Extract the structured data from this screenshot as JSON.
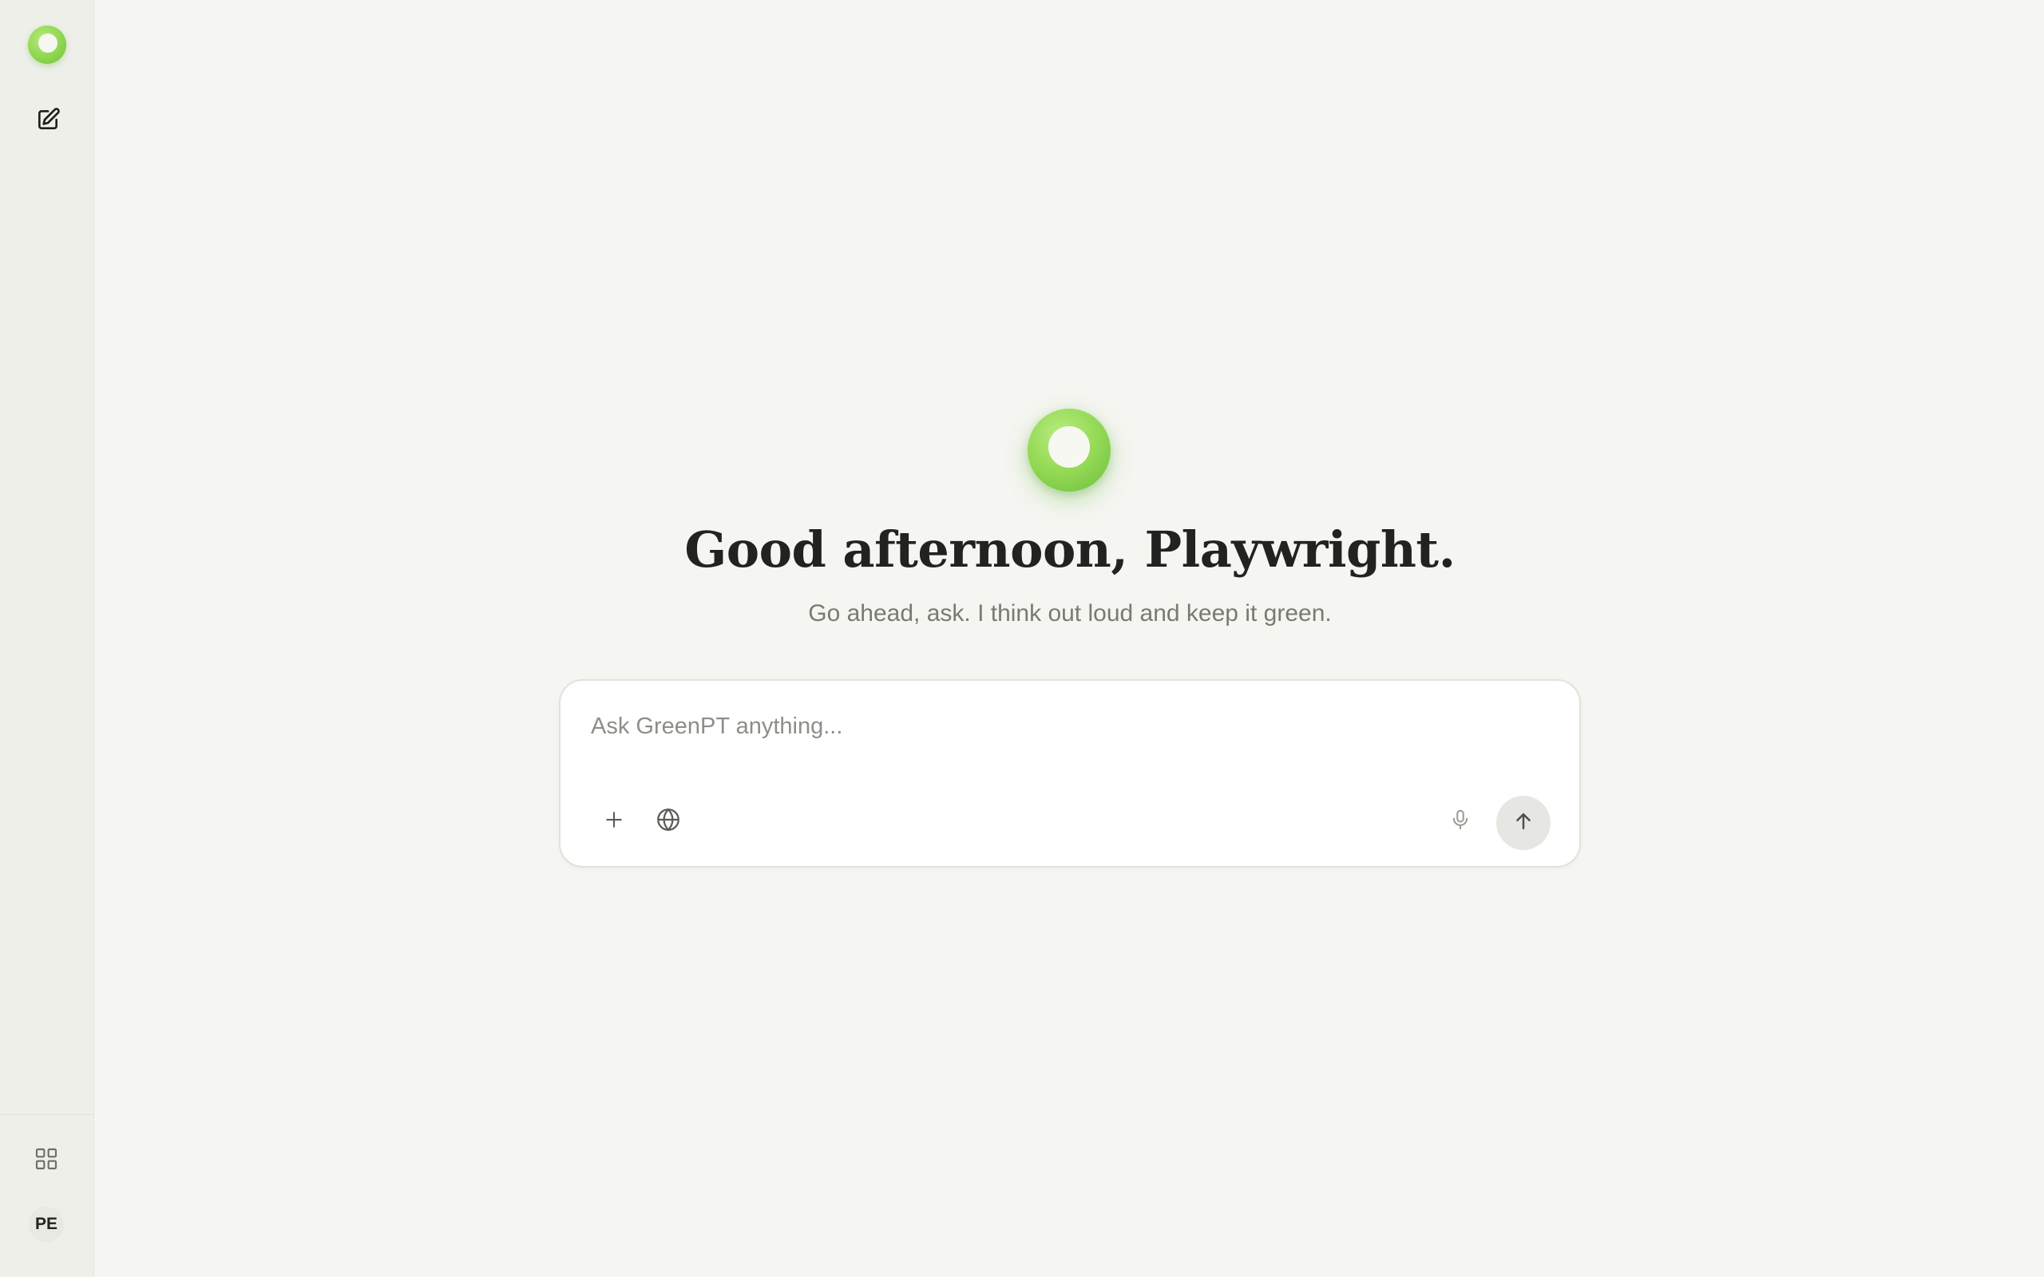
{
  "sidebar": {
    "logo_icon": "greenpt-logo-icon",
    "new_chat_icon": "compose-icon",
    "apps_icon": "grid-icon",
    "avatar_initials": "PE"
  },
  "main": {
    "hero_icon": "greenpt-logo-icon",
    "greeting": "Good afternoon, Playwright.",
    "subtitle": "Go ahead, ask. I think out loud and keep it green."
  },
  "composer": {
    "placeholder": "Ask GreenPT anything...",
    "value": "",
    "attach_icon": "plus-icon",
    "web_search_icon": "globe-icon",
    "voice_icon": "microphone-icon",
    "send_icon": "arrow-up-icon"
  },
  "colors": {
    "accent_green": "#8fd651",
    "background": "#f5f5f1",
    "sidebar_bg": "#efefea",
    "text_primary": "#222220",
    "text_secondary": "#7a7a74"
  }
}
